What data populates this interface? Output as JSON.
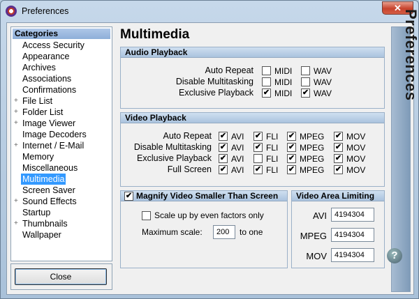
{
  "window": {
    "title": "Preferences",
    "close_glyph": "✕"
  },
  "sidebar": {
    "header": "Categories",
    "items": [
      {
        "label": "Access Security",
        "expandable": false
      },
      {
        "label": "Appearance",
        "expandable": false
      },
      {
        "label": "Archives",
        "expandable": false
      },
      {
        "label": "Associations",
        "expandable": false
      },
      {
        "label": "Confirmations",
        "expandable": false
      },
      {
        "label": "File List",
        "expandable": true
      },
      {
        "label": "Folder List",
        "expandable": true
      },
      {
        "label": "Image Viewer",
        "expandable": true
      },
      {
        "label": "Image Decoders",
        "expandable": false
      },
      {
        "label": "Internet / E-Mail",
        "expandable": true
      },
      {
        "label": "Memory",
        "expandable": false
      },
      {
        "label": "Miscellaneous",
        "expandable": false
      },
      {
        "label": "Multimedia",
        "expandable": false,
        "selected": true
      },
      {
        "label": "Screen Saver",
        "expandable": false
      },
      {
        "label": "Sound Effects",
        "expandable": true
      },
      {
        "label": "Startup",
        "expandable": false
      },
      {
        "label": "Thumbnails",
        "expandable": true
      },
      {
        "label": "Wallpaper",
        "expandable": false
      }
    ],
    "plus_glyph": "+"
  },
  "close_button": "Close",
  "page_title": "Multimedia",
  "banner": "Preferences",
  "help_glyph": "?",
  "audio": {
    "title": "Audio Playback",
    "columns": [
      "MIDI",
      "WAV"
    ],
    "rows": [
      {
        "label": "Auto Repeat",
        "checked": [
          false,
          false
        ]
      },
      {
        "label": "Disable Multitasking",
        "checked": [
          false,
          false
        ]
      },
      {
        "label": "Exclusive Playback",
        "checked": [
          true,
          true
        ]
      }
    ]
  },
  "video": {
    "title": "Video Playback",
    "columns": [
      "AVI",
      "FLI",
      "MPEG",
      "MOV"
    ],
    "rows": [
      {
        "label": "Auto Repeat",
        "checked": [
          true,
          true,
          true,
          true
        ]
      },
      {
        "label": "Disable Multitasking",
        "checked": [
          true,
          true,
          true,
          true
        ]
      },
      {
        "label": "Exclusive Playback",
        "checked": [
          true,
          false,
          true,
          true
        ]
      },
      {
        "label": "Full Screen",
        "checked": [
          true,
          true,
          true,
          true
        ]
      }
    ]
  },
  "magnify": {
    "title": "Magnify Video Smaller Than Screen",
    "checked": true,
    "scale_even_label": "Scale up by even factors only",
    "scale_even_checked": false,
    "max_scale_label": "Maximum scale:",
    "max_scale_value": "200",
    "max_scale_suffix": "to one"
  },
  "limits": {
    "title": "Video Area Limiting",
    "rows": [
      {
        "label": "AVI",
        "value": "4194304"
      },
      {
        "label": "MPEG",
        "value": "4194304"
      },
      {
        "label": "MOV",
        "value": "4194304"
      }
    ]
  },
  "check_glyph": "✔"
}
